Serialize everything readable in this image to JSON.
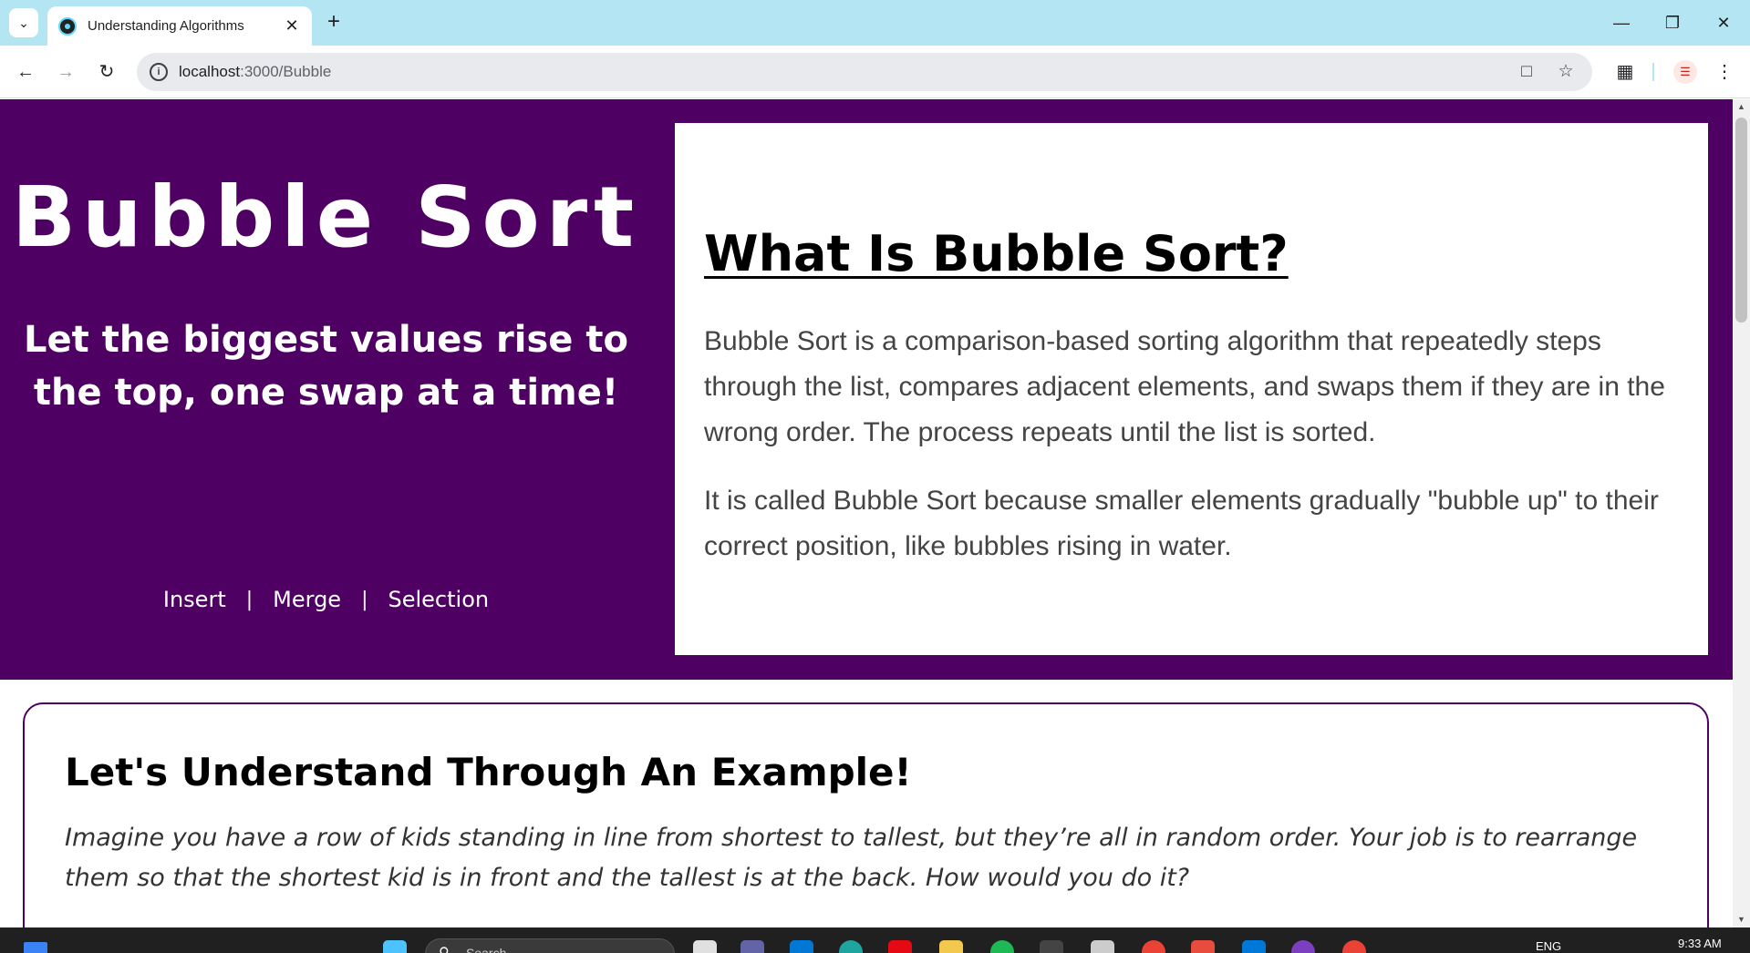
{
  "browser": {
    "tab_title": "Understanding Algorithms",
    "url_host": "localhost",
    "url_path": ":3000/Bubble",
    "icons": {
      "tab_menu": "chevron-down-icon",
      "tab_close": "close-icon",
      "new_tab": "plus-icon",
      "minimize": "minimize-icon",
      "restore": "restore-icon",
      "close_window": "close-icon",
      "back": "arrow-left-icon",
      "forward": "arrow-right-icon",
      "reload": "reload-icon",
      "site_info": "info-icon",
      "install": "install-app-icon",
      "bookmark": "star-icon",
      "extensions": "puzzle-icon",
      "menu": "kebab-menu-icon"
    }
  },
  "hero": {
    "title": "Bubble Sort",
    "subtitle": "Let the biggest values rise to the top, one swap at a time!",
    "links": [
      "Insert",
      "Merge",
      "Selection"
    ],
    "separator": "|",
    "background": "#4f0063"
  },
  "info_card": {
    "heading": "What Is Bubble Sort?",
    "paragraphs": [
      "Bubble Sort is a comparison-based sorting algorithm that repeatedly steps through the list, compares adjacent elements, and swaps them if they are in the wrong order. The process repeats until the list is sorted.",
      "It is called Bubble Sort because smaller elements gradually \"bubble up\" to their correct position, like bubbles rising in water."
    ]
  },
  "example": {
    "heading": "Let's Understand Through An Example!",
    "text": "Imagine you have a row of kids standing in line from shortest to tallest, but they’re all in random order. Your job is to rearrange them so that the shortest kid is in front and the tallest is at the back. How would you do it?",
    "border_color": "#4f0063"
  },
  "taskbar": {
    "search_placeholder": "Search",
    "language": "ENG",
    "time": "9:33 AM"
  }
}
